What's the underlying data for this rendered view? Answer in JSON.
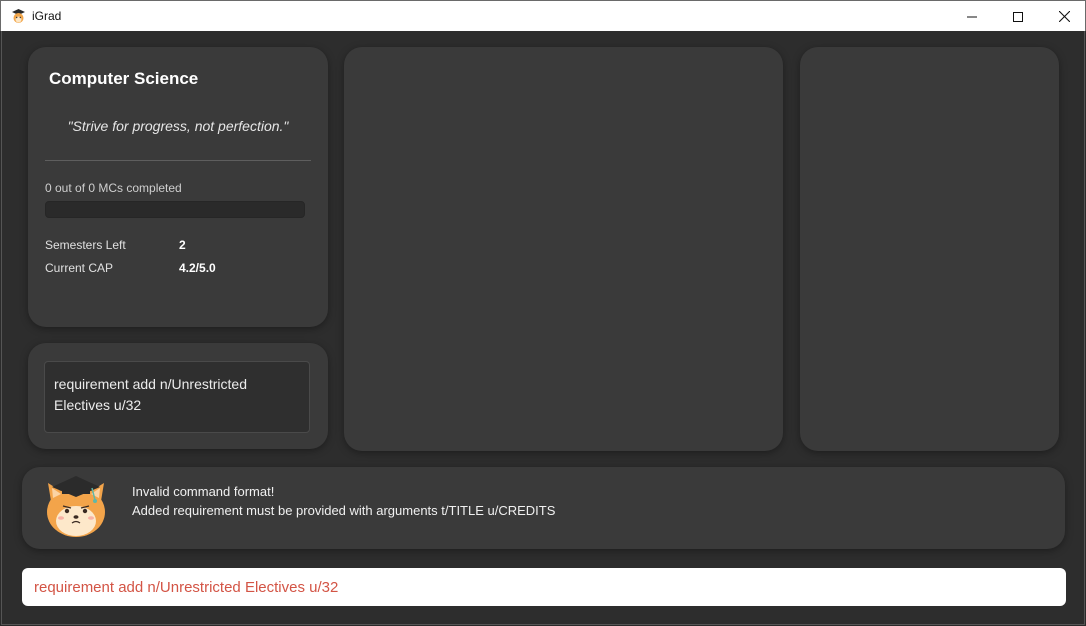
{
  "window": {
    "title": "iGrad",
    "icon": "graduate-dog-icon"
  },
  "profile": {
    "course_title": "Computer Science",
    "quote": "\"Strive for progress, not perfection.\"",
    "mcs_text": "0 out of 0 MCs completed",
    "progress_fraction": 0,
    "stats": [
      {
        "label": "Semesters Left",
        "value": "2"
      },
      {
        "label": "Current CAP",
        "value": "4.2/5.0"
      }
    ]
  },
  "command_card": {
    "text": "requirement add n/Unrestricted Electives u/32"
  },
  "result": {
    "mascot_icon": "shiba-graduate-mascot-icon",
    "lines": [
      "Invalid command format!",
      "Added requirement must be provided with arguments t/TITLE u/CREDITS"
    ]
  },
  "command_input": {
    "value": "requirement add n/Unrestricted Electives u/32",
    "error_color": "#d35445"
  },
  "colors": {
    "background": "#2d2d2d",
    "card": "#3a3a3a",
    "titlebar": "#ffffff"
  }
}
